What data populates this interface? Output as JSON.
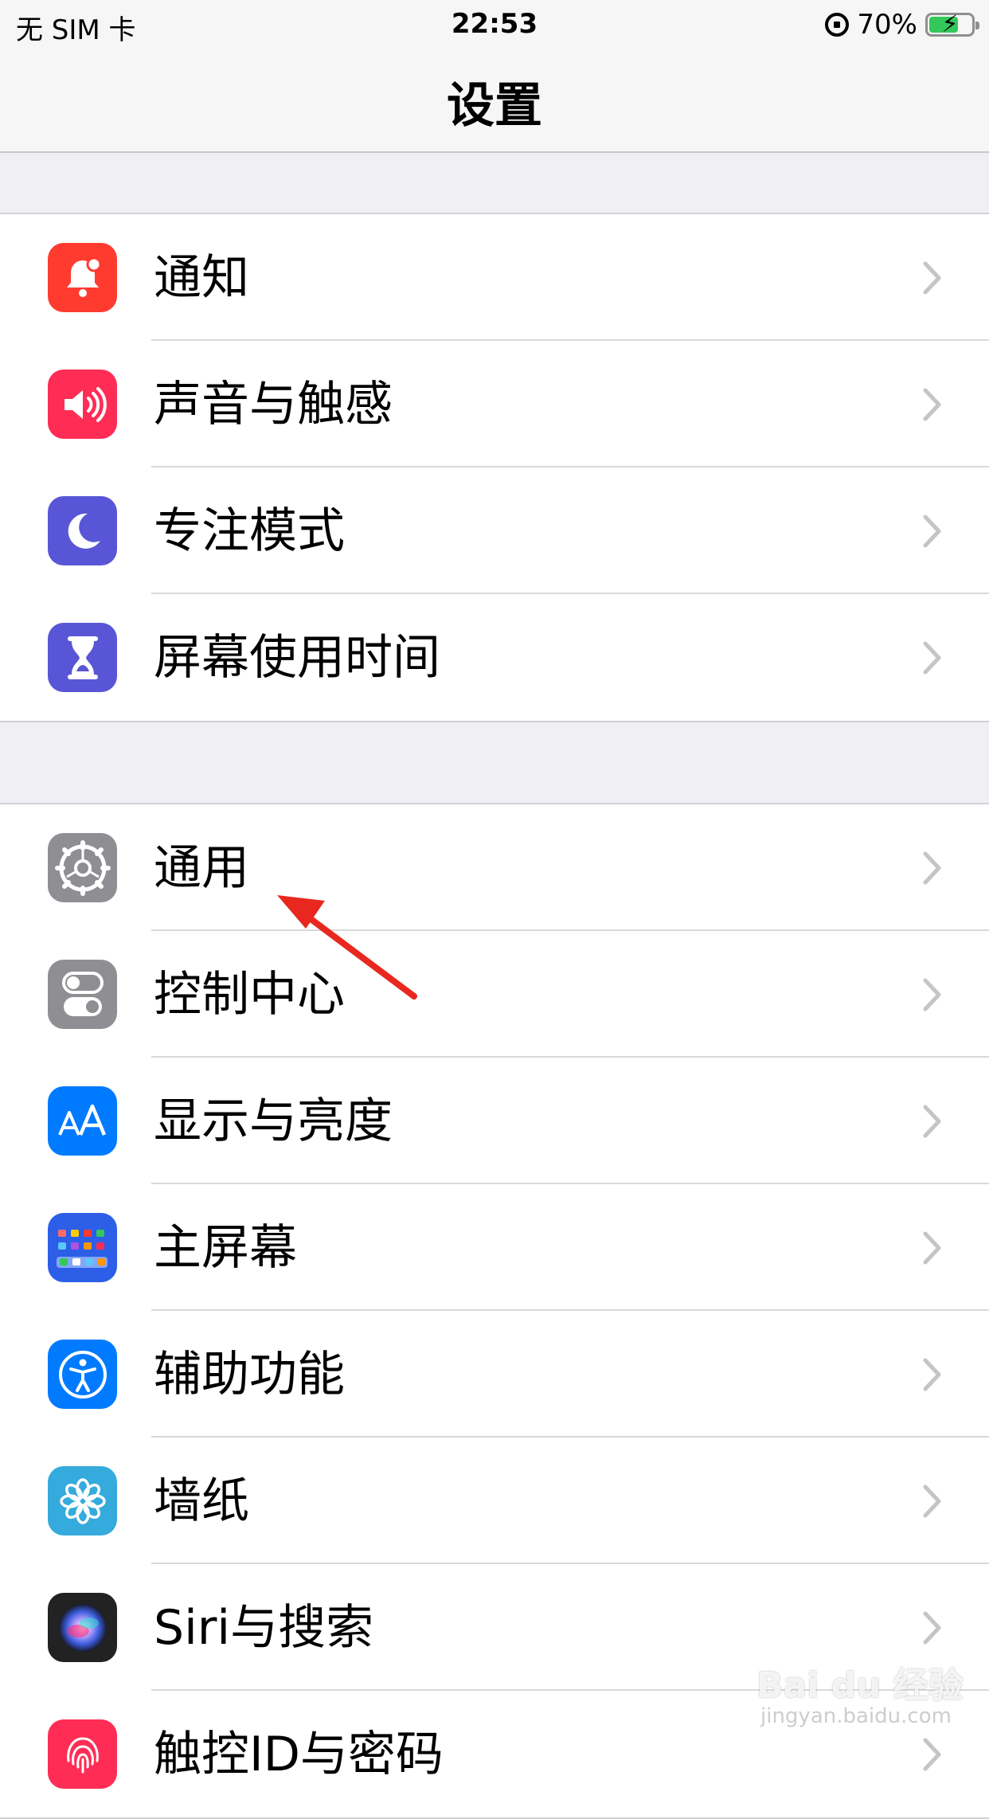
{
  "status_bar": {
    "carrier": "无 SIM 卡",
    "time": "22:53",
    "battery_percent": "70%",
    "battery_level": 0.7,
    "battery_color": "#34c759"
  },
  "nav": {
    "title": "设置"
  },
  "groups": [
    {
      "items": [
        {
          "label": "通知",
          "icon": "bell-icon",
          "color": "#ff3b30"
        },
        {
          "label": "声音与触感",
          "icon": "speaker-icon",
          "color": "#ff2d55"
        },
        {
          "label": "专注模式",
          "icon": "moon-icon",
          "color": "#5856d6"
        },
        {
          "label": "屏幕使用时间",
          "icon": "hourglass-icon",
          "color": "#5856d6"
        }
      ]
    },
    {
      "items": [
        {
          "label": "通用",
          "icon": "gear-icon",
          "color": "#8e8e93"
        },
        {
          "label": "控制中心",
          "icon": "toggles-icon",
          "color": "#8e8e93"
        },
        {
          "label": "显示与亮度",
          "icon": "text-size-icon",
          "color": "#007aff"
        },
        {
          "label": "主屏幕",
          "icon": "home-grid-icon",
          "color": "#2c5ee8"
        },
        {
          "label": "辅助功能",
          "icon": "accessibility-icon",
          "color": "#007aff"
        },
        {
          "label": "墙纸",
          "icon": "flower-icon",
          "color": "#35aadc"
        },
        {
          "label": "Siri与搜索",
          "icon": "siri-icon",
          "color": "#222222"
        },
        {
          "label": "触控ID与密码",
          "icon": "fingerprint-icon",
          "color": "#ff2d55"
        }
      ]
    }
  ],
  "annotation": {
    "arrow_color": "#e8281e",
    "target": "通用"
  },
  "watermark": {
    "brand": "Bai du 经验",
    "url": "jingyan.baidu.com"
  }
}
